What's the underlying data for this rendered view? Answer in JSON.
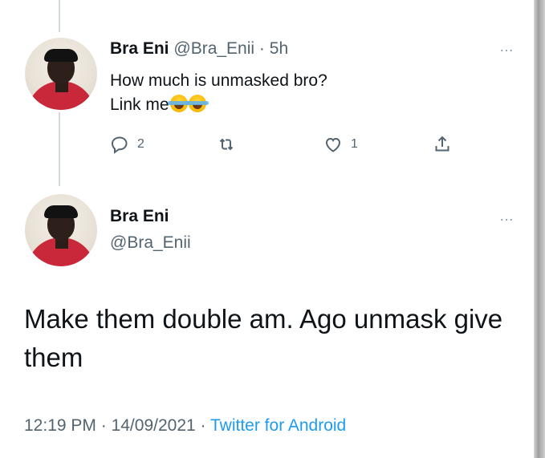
{
  "reply": {
    "name": "Bra Eni",
    "handle": "@Bra_Enii",
    "separator": "·",
    "time": "5h",
    "text_line1": "How much is unmasked bro?",
    "text_line2": "Link me",
    "emojis": [
      "face-with-tears-of-joy",
      "face-with-tears-of-joy"
    ],
    "reply_count": "2",
    "like_count": "1",
    "more_icon": "…"
  },
  "tweet": {
    "name": "Bra Eni",
    "handle": "@Bra_Enii",
    "text": "Make them double am. Ago unmask give them",
    "time": "12:19 PM",
    "date": "14/09/2021",
    "separator": "·",
    "source": "Twitter for Android",
    "more_icon": "…"
  },
  "colors": {
    "text": "#0f1419",
    "muted": "#536471",
    "link": "#1d9bf0",
    "thread_line": "#cfd9de"
  }
}
